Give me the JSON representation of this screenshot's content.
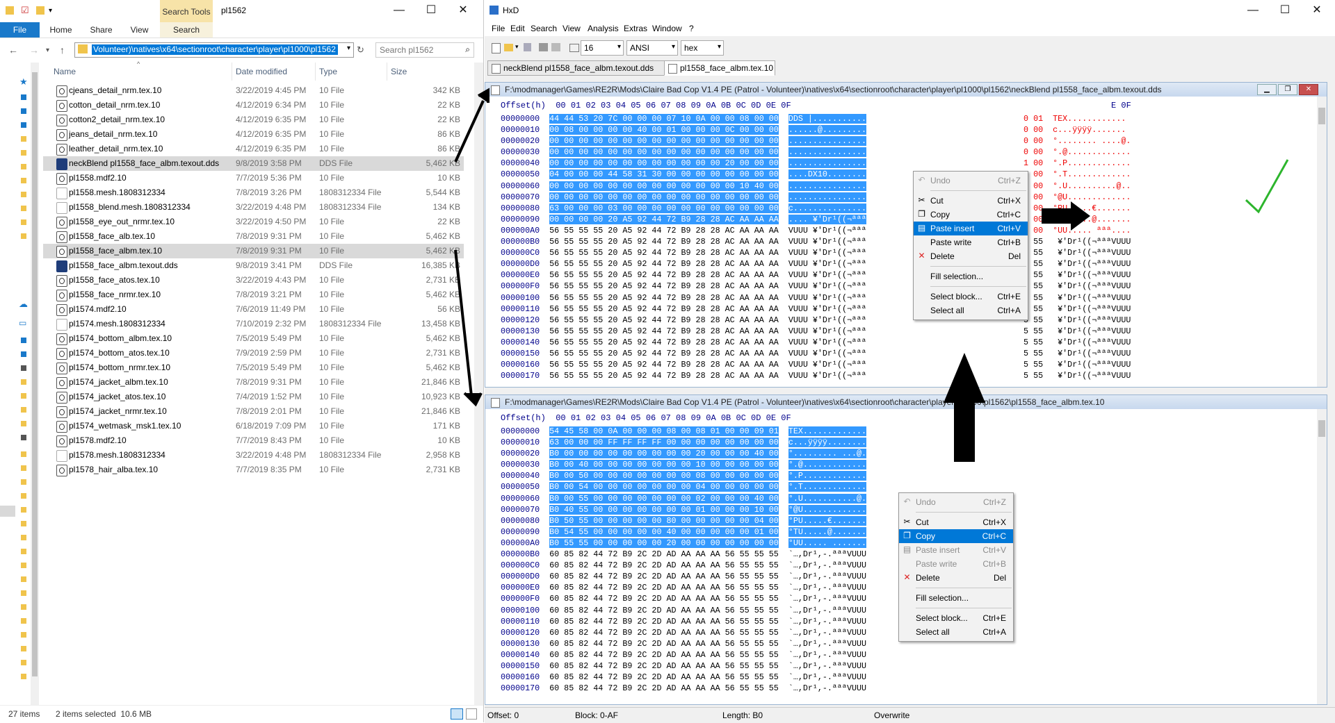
{
  "explorer": {
    "search_tools_tab": "Search Tools",
    "window_title": "pl1562",
    "ribbon_tabs": [
      "File",
      "Home",
      "Share",
      "View",
      "Search"
    ],
    "address": "Volunteer)\\natives\\x64\\sectionroot\\character\\player\\pl1000\\pl1562",
    "search_placeholder": "Search pl1562",
    "columns": {
      "name": "Name",
      "date": "Date modified",
      "type": "Type",
      "size": "Size"
    },
    "files": [
      {
        "name": "cjeans_detail_nrm.tex.10",
        "date": "3/22/2019 4:45 PM",
        "type": "10 File",
        "size": "342 KB",
        "icon": "tex-file-icon"
      },
      {
        "name": "cotton_detail_nrm.tex.10",
        "date": "4/12/2019 6:34 PM",
        "type": "10 File",
        "size": "22 KB",
        "icon": "tex-file-icon"
      },
      {
        "name": "cotton2_detail_nrm.tex.10",
        "date": "4/12/2019 6:35 PM",
        "type": "10 File",
        "size": "22 KB",
        "icon": "tex-file-icon"
      },
      {
        "name": "jeans_detail_nrm.tex.10",
        "date": "4/12/2019 6:35 PM",
        "type": "10 File",
        "size": "86 KB",
        "icon": "tex-file-icon"
      },
      {
        "name": "leather_detail_nrm.tex.10",
        "date": "4/12/2019 6:35 PM",
        "type": "10 File",
        "size": "86 KB",
        "icon": "tex-file-icon"
      },
      {
        "name": "neckBlend pl1558_face_albm.texout.dds",
        "date": "9/8/2019 3:58 PM",
        "type": "DDS File",
        "size": "5,462 KB",
        "icon": "dds-file-icon",
        "selected": true
      },
      {
        "name": "pl1558.mdf2.10",
        "date": "7/7/2019 5:36 PM",
        "type": "10 File",
        "size": "10 KB",
        "icon": "tex-file-icon"
      },
      {
        "name": "pl1558.mesh.1808312334",
        "date": "7/8/2019 3:26 PM",
        "type": "1808312334 File",
        "size": "5,544 KB",
        "icon": "blank-file-icon"
      },
      {
        "name": "pl1558_blend.mesh.1808312334",
        "date": "3/22/2019 4:48 PM",
        "type": "1808312334 File",
        "size": "134 KB",
        "icon": "blank-file-icon"
      },
      {
        "name": "pl1558_eye_out_nrmr.tex.10",
        "date": "3/22/2019 4:50 PM",
        "type": "10 File",
        "size": "22 KB",
        "icon": "tex-file-icon"
      },
      {
        "name": "pl1558_face_alb.tex.10",
        "date": "7/8/2019 9:31 PM",
        "type": "10 File",
        "size": "5,462 KB",
        "icon": "tex-file-icon"
      },
      {
        "name": "pl1558_face_albm.tex.10",
        "date": "7/8/2019 9:31 PM",
        "type": "10 File",
        "size": "5,462 KB",
        "icon": "tex-file-icon",
        "selected": true
      },
      {
        "name": "pl1558_face_albm.texout.dds",
        "date": "9/8/2019 3:41 PM",
        "type": "DDS File",
        "size": "16,385 KB",
        "icon": "dds-file-icon"
      },
      {
        "name": "pl1558_face_atos.tex.10",
        "date": "3/22/2019 4:43 PM",
        "type": "10 File",
        "size": "2,731 KB",
        "icon": "tex-file-icon"
      },
      {
        "name": "pl1558_face_nrmr.tex.10",
        "date": "7/8/2019 3:21 PM",
        "type": "10 File",
        "size": "5,462 KB",
        "icon": "tex-file-icon"
      },
      {
        "name": "pl1574.mdf2.10",
        "date": "7/6/2019 11:49 PM",
        "type": "10 File",
        "size": "56 KB",
        "icon": "tex-file-icon"
      },
      {
        "name": "pl1574.mesh.1808312334",
        "date": "7/10/2019 2:32 PM",
        "type": "1808312334 File",
        "size": "13,458 KB",
        "icon": "blank-file-icon"
      },
      {
        "name": "pl1574_bottom_albm.tex.10",
        "date": "7/5/2019 5:49 PM",
        "type": "10 File",
        "size": "5,462 KB",
        "icon": "tex-file-icon"
      },
      {
        "name": "pl1574_bottom_atos.tex.10",
        "date": "7/9/2019 2:59 PM",
        "type": "10 File",
        "size": "2,731 KB",
        "icon": "tex-file-icon"
      },
      {
        "name": "pl1574_bottom_nrmr.tex.10",
        "date": "7/5/2019 5:49 PM",
        "type": "10 File",
        "size": "5,462 KB",
        "icon": "tex-file-icon"
      },
      {
        "name": "pl1574_jacket_albm.tex.10",
        "date": "7/8/2019 9:31 PM",
        "type": "10 File",
        "size": "21,846 KB",
        "icon": "tex-file-icon"
      },
      {
        "name": "pl1574_jacket_atos.tex.10",
        "date": "7/4/2019 1:52 PM",
        "type": "10 File",
        "size": "10,923 KB",
        "icon": "tex-file-icon"
      },
      {
        "name": "pl1574_jacket_nrmr.tex.10",
        "date": "7/8/2019 2:01 PM",
        "type": "10 File",
        "size": "21,846 KB",
        "icon": "tex-file-icon"
      },
      {
        "name": "pl1574_wetmask_msk1.tex.10",
        "date": "6/18/2019 7:09 PM",
        "type": "10 File",
        "size": "171 KB",
        "icon": "tex-file-icon"
      },
      {
        "name": "pl1578.mdf2.10",
        "date": "7/7/2019 8:43 PM",
        "type": "10 File",
        "size": "10 KB",
        "icon": "tex-file-icon"
      },
      {
        "name": "pl1578.mesh.1808312334",
        "date": "3/22/2019 4:48 PM",
        "type": "1808312334 File",
        "size": "2,958 KB",
        "icon": "blank-file-icon"
      },
      {
        "name": "pl1578_hair_alba.tex.10",
        "date": "7/7/2019 8:35 PM",
        "type": "10 File",
        "size": "2,731 KB",
        "icon": "tex-file-icon"
      }
    ],
    "status": {
      "count": "27 items",
      "selected": "2 items selected  10.6 MB"
    }
  },
  "hxd": {
    "title": "HxD",
    "menu": [
      "File",
      "Edit",
      "Search",
      "View",
      "Analysis",
      "Extras",
      "Window",
      "?"
    ],
    "toolbar": {
      "bytes_per_row": "16",
      "charset": "ANSI",
      "mode": "hex"
    },
    "tabs": [
      "neckBlend pl1558_face_albm.texout.dds",
      "pl1558_face_albm.tex.10"
    ],
    "offset_header": "Offset(h)  00 01 02 03 04 05 06 07 08 09 0A 0B 0C 0D 0E 0F",
    "top_pane": {
      "path": "F:\\modmanager\\Games\\RE2R\\Mods\\Claire Bad Cop V1.4 PE (Patrol - Volunteer)\\natives\\x64\\sectionroot\\character\\player\\pl1000\\pl1562\\neckBlend pl1558_face_albm.texout.dds",
      "right_header": "E 0F",
      "lines": [
        {
          "off": "00000000",
          "hex": "44 44 53 20 7C 00 00 00 07 10 0A 00 00 08 00 00",
          "asc": "DDS |...........",
          "rb": "0 01",
          "ra": "TEX............"
        },
        {
          "off": "00000010",
          "hex": "00 08 00 00 00 00 40 00 01 00 00 00 0C 00 00 00",
          "asc": "......@.........",
          "rb": "0 00",
          "ra": "c...ÿÿÿÿ......."
        },
        {
          "off": "00000020",
          "hex": "00 00 00 00 00 00 00 00 00 00 00 00 00 00 00 00",
          "asc": "................",
          "rb": "0 00",
          "ra": "°........ ....@."
        },
        {
          "off": "00000030",
          "hex": "00 00 00 00 00 00 00 00 00 00 00 00 00 00 00 00",
          "asc": "................",
          "rb": "0 00",
          "ra": "°.@............."
        },
        {
          "off": "00000040",
          "hex": "00 00 00 00 00 00 00 00 00 00 00 00 20 00 00 00",
          "asc": "................",
          "rb": "1 00",
          "ra": "°.P............."
        },
        {
          "off": "00000050",
          "hex": "04 00 00 00 44 58 31 30 00 00 00 00 00 00 00 00",
          "asc": "....DX10........",
          "rb": "0 00",
          "ra": "°.T............."
        },
        {
          "off": "00000060",
          "hex": "00 00 00 00 00 00 00 00 00 00 00 00 00 10 40 00",
          "asc": "................",
          "rb": "0 00",
          "ra": "°.U..........@.."
        },
        {
          "off": "00000070",
          "hex": "00 00 00 00 00 00 00 00 00 00 00 00 00 00 00 00",
          "asc": "................",
          "rb": "0 00",
          "ra": "°@U............."
        },
        {
          "off": "00000080",
          "hex": "63 00 00 00 03 00 00 00 00 00 00 00 00 00 00 00",
          "asc": "c...............",
          "rb": "0 00",
          "ra": "°PU.....€......."
        },
        {
          "off": "00000090",
          "hex": "00 00 00 00 20 A5 92 44 72 B9 28 28 AC AA AA AA",
          "asc": ".... ¥'Dr¹((¬ªªª",
          "rb": "0 00",
          "ra": "°TU.....@......."
        },
        {
          "off": "000000A0",
          "hex": "56 55 55 55 20 A5 92 44 72 B9 28 28 AC AA AA AA",
          "asc": "VUUU ¥'Dr¹((¬ªªª",
          "rb": "0 00",
          "ra": "°UU..... ªªª...."
        },
        {
          "off": "000000B0",
          "hex": "56 55 55 55 20 A5 92 44 72 B9 28 28 AC AA AA AA",
          "asc": "VUUU ¥'Dr¹((¬ªªª",
          "rb": "5 55",
          "ra": " ¥'Dr¹((¬ªªªVUUU"
        },
        {
          "off": "000000C0",
          "hex": "56 55 55 55 20 A5 92 44 72 B9 28 28 AC AA AA AA",
          "asc": "VUUU ¥'Dr¹((¬ªªª",
          "rb": "5 55",
          "ra": " ¥'Dr¹((¬ªªªVUUU"
        },
        {
          "off": "000000D0",
          "hex": "56 55 55 55 20 A5 92 44 72 B9 28 28 AC AA AA AA",
          "asc": "VUUU ¥'Dr¹((¬ªªª",
          "rb": "5 55",
          "ra": " ¥'Dr¹((¬ªªªVUUU"
        },
        {
          "off": "000000E0",
          "hex": "56 55 55 55 20 A5 92 44 72 B9 28 28 AC AA AA AA",
          "asc": "VUUU ¥'Dr¹((¬ªªª",
          "rb": "5 55",
          "ra": " ¥'Dr¹((¬ªªªVUUU"
        },
        {
          "off": "000000F0",
          "hex": "56 55 55 55 20 A5 92 44 72 B9 28 28 AC AA AA AA",
          "asc": "VUUU ¥'Dr¹((¬ªªª",
          "rb": "5 55",
          "ra": " ¥'Dr¹((¬ªªªVUUU"
        },
        {
          "off": "00000100",
          "hex": "56 55 55 55 20 A5 92 44 72 B9 28 28 AC AA AA AA",
          "asc": "VUUU ¥'Dr¹((¬ªªª",
          "rb": "5 55",
          "ra": " ¥'Dr¹((¬ªªªVUUU"
        },
        {
          "off": "00000110",
          "hex": "56 55 55 55 20 A5 92 44 72 B9 28 28 AC AA AA AA",
          "asc": "VUUU ¥'Dr¹((¬ªªª",
          "rb": "5 55",
          "ra": " ¥'Dr¹((¬ªªªVUUU"
        },
        {
          "off": "00000120",
          "hex": "56 55 55 55 20 A5 92 44 72 B9 28 28 AC AA AA AA",
          "asc": "VUUU ¥'Dr¹((¬ªªª",
          "rb": "5 55",
          "ra": " ¥'Dr¹((¬ªªªVUUU"
        },
        {
          "off": "00000130",
          "hex": "56 55 55 55 20 A5 92 44 72 B9 28 28 AC AA AA AA",
          "asc": "VUUU ¥'Dr¹((¬ªªª",
          "rb": "5 55",
          "ra": " ¥'Dr¹((¬ªªªVUUU"
        },
        {
          "off": "00000140",
          "hex": "56 55 55 55 20 A5 92 44 72 B9 28 28 AC AA AA AA",
          "asc": "VUUU ¥'Dr¹((¬ªªª",
          "rb": "5 55",
          "ra": " ¥'Dr¹((¬ªªªVUUU"
        },
        {
          "off": "00000150",
          "hex": "56 55 55 55 20 A5 92 44 72 B9 28 28 AC AA AA AA",
          "asc": "VUUU ¥'Dr¹((¬ªªª",
          "rb": "5 55",
          "ra": " ¥'Dr¹((¬ªªªVUUU"
        },
        {
          "off": "00000160",
          "hex": "56 55 55 55 20 A5 92 44 72 B9 28 28 AC AA AA AA",
          "asc": "VUUU ¥'Dr¹((¬ªªª",
          "rb": "5 55",
          "ra": " ¥'Dr¹((¬ªªªVUUU"
        },
        {
          "off": "00000170",
          "hex": "56 55 55 55 20 A5 92 44 72 B9 28 28 AC AA AA AA",
          "asc": "VUUU ¥'Dr¹((¬ªªª",
          "rb": "5 55",
          "ra": " ¥'Dr¹((¬ªªªVUUU"
        }
      ]
    },
    "bottom_pane": {
      "path": "F:\\modmanager\\Games\\RE2R\\Mods\\Claire Bad Cop V1.4 PE (Patrol - Volunteer)\\natives\\x64\\sectionroot\\character\\player\\pl1000\\pl1562\\pl1558_face_albm.tex.10",
      "lines": [
        {
          "off": "00000000",
          "hex": "54 45 58 00 0A 00 00 00 08 00 08 01 00 00 09 01",
          "asc": "TEX............."
        },
        {
          "off": "00000010",
          "hex": "63 00 00 00 FF FF FF FF 00 00 00 00 00 00 00 00",
          "asc": "c...ÿÿÿÿ........"
        },
        {
          "off": "00000020",
          "hex": "B0 00 00 00 00 00 00 00 00 00 20 00 00 00 40 00",
          "asc": "°......... ...@."
        },
        {
          "off": "00000030",
          "hex": "B0 00 40 00 00 00 00 00 00 00 10 00 00 00 00 00",
          "asc": "°.@............."
        },
        {
          "off": "00000040",
          "hex": "B0 00 50 00 00 00 00 00 00 00 08 00 00 00 00 00",
          "asc": "°.P............."
        },
        {
          "off": "00000050",
          "hex": "B0 00 54 00 00 00 00 00 00 00 04 00 00 00 00 00",
          "asc": "°.T............."
        },
        {
          "off": "00000060",
          "hex": "B0 00 55 00 00 00 00 00 00 00 02 00 00 00 40 00",
          "asc": "°.U...........@."
        },
        {
          "off": "00000070",
          "hex": "B0 40 55 00 00 00 00 00 00 00 01 00 00 00 10 00",
          "asc": "°@U............."
        },
        {
          "off": "00000080",
          "hex": "B0 50 55 00 00 00 00 00 80 00 00 00 00 00 04 00",
          "asc": "°PU.....€......."
        },
        {
          "off": "00000090",
          "hex": "B0 54 55 00 00 00 00 00 40 00 00 00 00 00 01 00",
          "asc": "°TU.....@......."
        },
        {
          "off": "000000A0",
          "hex": "B0 55 55 00 00 00 00 00 20 00 00 00 00 00 00 00",
          "asc": "°UU..... ......."
        },
        {
          "off": "000000B0",
          "hex": "60 85 82 44 72 B9 2C 2D AD AA AA AA 56 55 55 55",
          "asc": "`…,Dr¹,-.ªªªVUUU"
        },
        {
          "off": "000000C0",
          "hex": "60 85 82 44 72 B9 2C 2D AD AA AA AA 56 55 55 55",
          "asc": "`…,Dr¹,-.ªªªVUUU"
        },
        {
          "off": "000000D0",
          "hex": "60 85 82 44 72 B9 2C 2D AD AA AA AA 56 55 55 55",
          "asc": "`…,Dr¹,-.ªªªVUUU"
        },
        {
          "off": "000000E0",
          "hex": "60 85 82 44 72 B9 2C 2D AD AA AA AA 56 55 55 55",
          "asc": "`…,Dr¹,-.ªªªVUUU"
        },
        {
          "off": "000000F0",
          "hex": "60 85 82 44 72 B9 2C 2D AD AA AA AA 56 55 55 55",
          "asc": "`…,Dr¹,-.ªªªVUUU"
        },
        {
          "off": "00000100",
          "hex": "60 85 82 44 72 B9 2C 2D AD AA AA AA 56 55 55 55",
          "asc": "`…,Dr¹,-.ªªªVUUU"
        },
        {
          "off": "00000110",
          "hex": "60 85 82 44 72 B9 2C 2D AD AA AA AA 56 55 55 55",
          "asc": "`…,Dr¹,-.ªªªVUUU"
        },
        {
          "off": "00000120",
          "hex": "60 85 82 44 72 B9 2C 2D AD AA AA AA 56 55 55 55",
          "asc": "`…,Dr¹,-.ªªªVUUU"
        },
        {
          "off": "00000130",
          "hex": "60 85 82 44 72 B9 2C 2D AD AA AA AA 56 55 55 55",
          "asc": "`…,Dr¹,-.ªªªVUUU"
        },
        {
          "off": "00000140",
          "hex": "60 85 82 44 72 B9 2C 2D AD AA AA AA 56 55 55 55",
          "asc": "`…,Dr¹,-.ªªªVUUU"
        },
        {
          "off": "00000150",
          "hex": "60 85 82 44 72 B9 2C 2D AD AA AA AA 56 55 55 55",
          "asc": "`…,Dr¹,-.ªªªVUUU"
        },
        {
          "off": "00000160",
          "hex": "60 85 82 44 72 B9 2C 2D AD AA AA AA 56 55 55 55",
          "asc": "`…,Dr¹,-.ªªªVUUU"
        },
        {
          "off": "00000170",
          "hex": "60 85 82 44 72 B9 2C 2D AD AA AA AA 56 55 55 55",
          "asc": "`…,Dr¹,-.ªªªVUUU"
        }
      ]
    },
    "context_top": [
      {
        "label": "Undo",
        "shortcut": "Ctrl+Z",
        "disabled": true,
        "icon": "undo-icon"
      },
      {
        "sep": true
      },
      {
        "label": "Cut",
        "shortcut": "Ctrl+X",
        "icon": "cut-icon"
      },
      {
        "label": "Copy",
        "shortcut": "Ctrl+C",
        "icon": "copy-icon"
      },
      {
        "label": "Paste insert",
        "shortcut": "Ctrl+V",
        "highlight": true,
        "icon": "paste-icon"
      },
      {
        "label": "Paste write",
        "shortcut": "Ctrl+B"
      },
      {
        "label": "Delete",
        "shortcut": "Del",
        "icon": "delete-icon"
      },
      {
        "sep": true
      },
      {
        "label": "Fill selection...",
        "shortcut": ""
      },
      {
        "sep": true
      },
      {
        "label": "Select block...",
        "shortcut": "Ctrl+E"
      },
      {
        "label": "Select all",
        "shortcut": "Ctrl+A"
      }
    ],
    "context_bottom": [
      {
        "label": "Undo",
        "shortcut": "Ctrl+Z",
        "disabled": true,
        "icon": "undo-icon"
      },
      {
        "sep": true
      },
      {
        "label": "Cut",
        "shortcut": "Ctrl+X",
        "icon": "cut-icon"
      },
      {
        "label": "Copy",
        "shortcut": "Ctrl+C",
        "highlight": true,
        "icon": "copy-icon"
      },
      {
        "label": "Paste insert",
        "shortcut": "Ctrl+V",
        "disabled": true,
        "icon": "paste-icon"
      },
      {
        "label": "Paste write",
        "shortcut": "Ctrl+B",
        "disabled": true
      },
      {
        "label": "Delete",
        "shortcut": "Del",
        "icon": "delete-icon"
      },
      {
        "sep": true
      },
      {
        "label": "Fill selection...",
        "shortcut": ""
      },
      {
        "sep": true
      },
      {
        "label": "Select block...",
        "shortcut": "Ctrl+E"
      },
      {
        "label": "Select all",
        "shortcut": "Ctrl+A"
      }
    ],
    "status": {
      "offset": "Offset: 0",
      "block": "Block: 0-AF",
      "length": "Length: B0",
      "mode": "Overwrite"
    }
  },
  "colors": {
    "selection": "#3399ff",
    "accent": "#0078d7",
    "checkmark": "#2db52d",
    "offset_text": "#00008b",
    "red_text": "#e00000"
  }
}
